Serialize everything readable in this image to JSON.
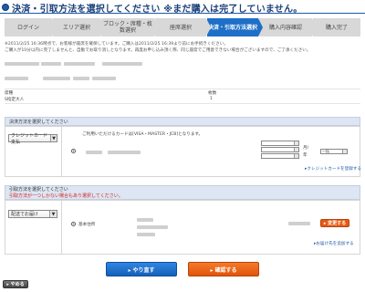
{
  "page": {
    "title": "決済・引取方法を選択してください ※まだ購入は完了していません。"
  },
  "steps": [
    {
      "label": "ログイン",
      "active": false
    },
    {
      "label": "エリア選択",
      "active": false
    },
    {
      "label": "ブロック・席種・枚数選択",
      "active": false
    },
    {
      "label": "座席選択",
      "active": false
    },
    {
      "label": "決済・引取方法選択",
      "active": true
    },
    {
      "label": "購入内容確認",
      "active": false
    },
    {
      "label": "購入完了",
      "active": false
    }
  ],
  "notice": {
    "line1": "※2011/2/25 16:36時点で、お客様が座席を確保しています。ご購入は2011/2/25 16:39より前にお手続きください。",
    "line2": "ご購入が10分以内に完了しませんと、自動でお取り消しとなります。再度お申し込み頂く際、同じ座席でご用意できない場合がございますので、ご了承ください。"
  },
  "summary": {
    "seat_type_header": "席種",
    "quantity_header": "枚数",
    "seat_type_value": "S指定大人",
    "quantity_value": "1"
  },
  "payment": {
    "header": "決済方法を選択してください",
    "method_selected": "クレジットカード支払",
    "card_note": "ご利用いただけるカードは[VISA・MASTER・JCB]となります。",
    "month_suffix": "月/",
    "year_suffix": "年",
    "installment": "一括",
    "register_link": "▸クレジットカードを登録する"
  },
  "pickup": {
    "header": "引取方法を選択してください",
    "warning": "引取方法が一つしかない場合もあり選択してください。",
    "method_selected": "配送でお届け",
    "address_label": "基本住所",
    "change_button": "▸ 変更する",
    "add_link": "▸お届け先を追加する"
  },
  "buttons": {
    "back": "▸ やり直す",
    "confirm": "▸ 確認する",
    "quit": "▸ やめる"
  },
  "colors": {
    "accent_blue": "#1e6fc8",
    "accent_orange": "#e85a10",
    "warning_red": "#d22020"
  }
}
